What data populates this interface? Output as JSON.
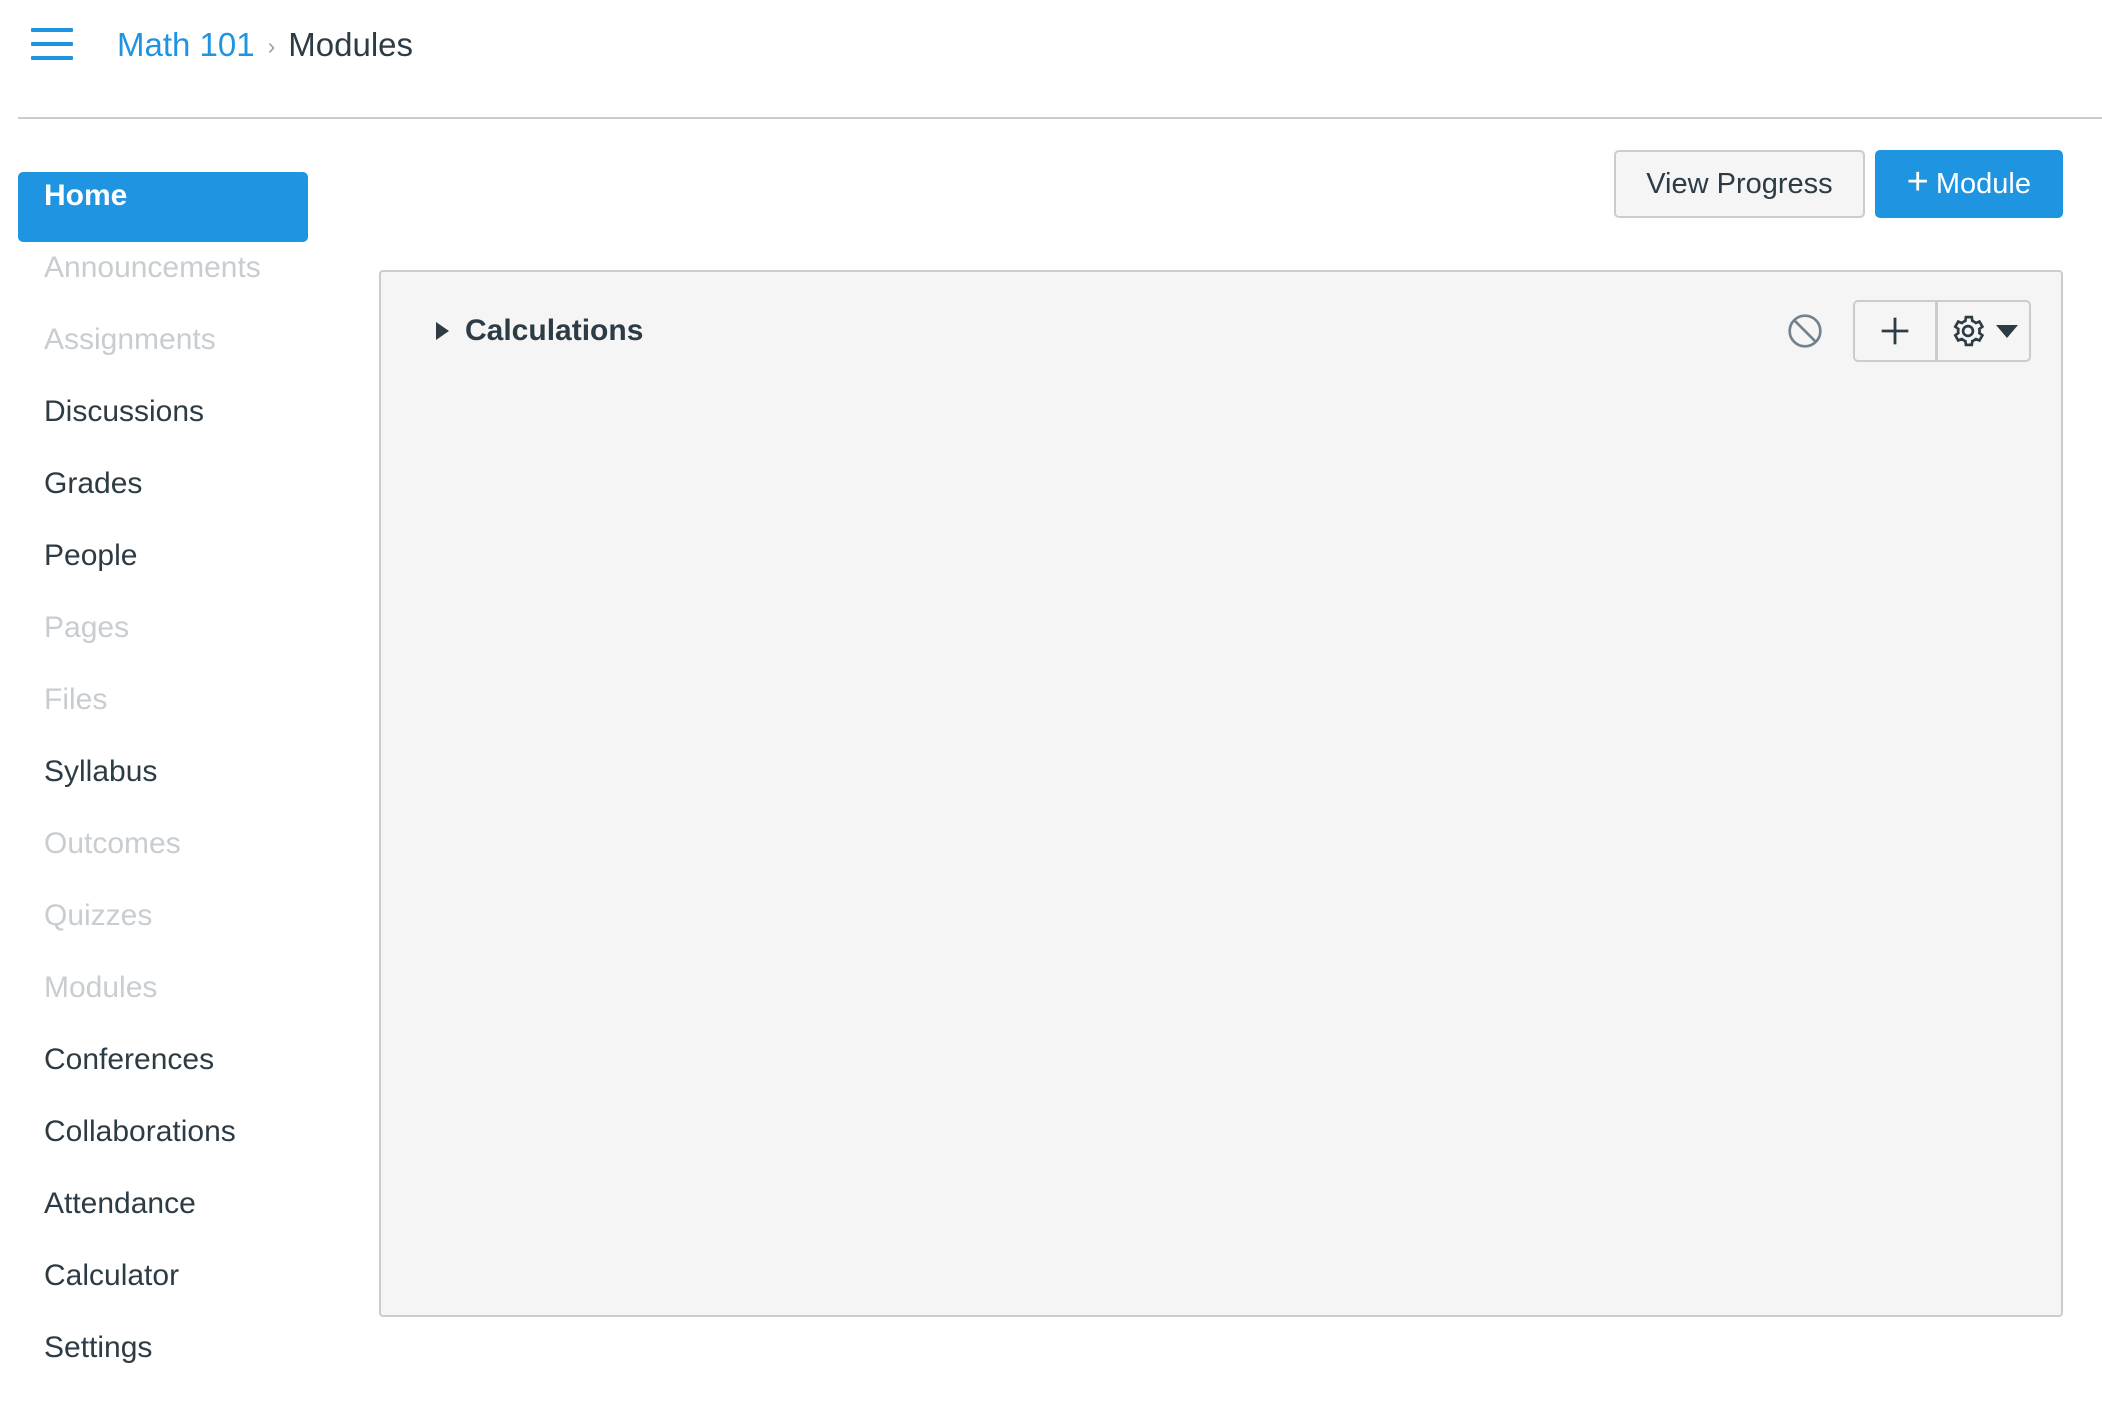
{
  "header": {
    "menu_icon": "hamburger-icon",
    "breadcrumb": {
      "course": "Math 101",
      "separator": "›",
      "current": "Modules"
    }
  },
  "sidebar": {
    "items": [
      {
        "label": "Home",
        "state": "active"
      },
      {
        "label": "Announcements",
        "state": "muted"
      },
      {
        "label": "Assignments",
        "state": "muted"
      },
      {
        "label": "Discussions",
        "state": "normal"
      },
      {
        "label": "Grades",
        "state": "normal"
      },
      {
        "label": "People",
        "state": "normal"
      },
      {
        "label": "Pages",
        "state": "muted"
      },
      {
        "label": "Files",
        "state": "muted"
      },
      {
        "label": "Syllabus",
        "state": "normal"
      },
      {
        "label": "Outcomes",
        "state": "muted"
      },
      {
        "label": "Quizzes",
        "state": "muted"
      },
      {
        "label": "Modules",
        "state": "muted"
      },
      {
        "label": "Conferences",
        "state": "normal"
      },
      {
        "label": "Collaborations",
        "state": "normal"
      },
      {
        "label": "Attendance",
        "state": "normal"
      },
      {
        "label": "Calculator",
        "state": "normal"
      },
      {
        "label": "Settings",
        "state": "normal"
      }
    ]
  },
  "toolbar": {
    "view_progress_label": "View Progress",
    "add_module_plus": "+",
    "add_module_label": "Module"
  },
  "modules": [
    {
      "title": "Calculations",
      "collapsed": true,
      "publish_state": "unpublished",
      "publish_icon": "circle-slash-icon",
      "add_item_icon": "plus-icon",
      "settings_icon": "gear-icon"
    }
  ],
  "colors": {
    "brand_blue": "#1f94e0",
    "text_dark": "#2d3b45",
    "text_muted": "#c7cdd1",
    "border": "#c7cdd1",
    "panel_bg": "#f5f5f5"
  }
}
